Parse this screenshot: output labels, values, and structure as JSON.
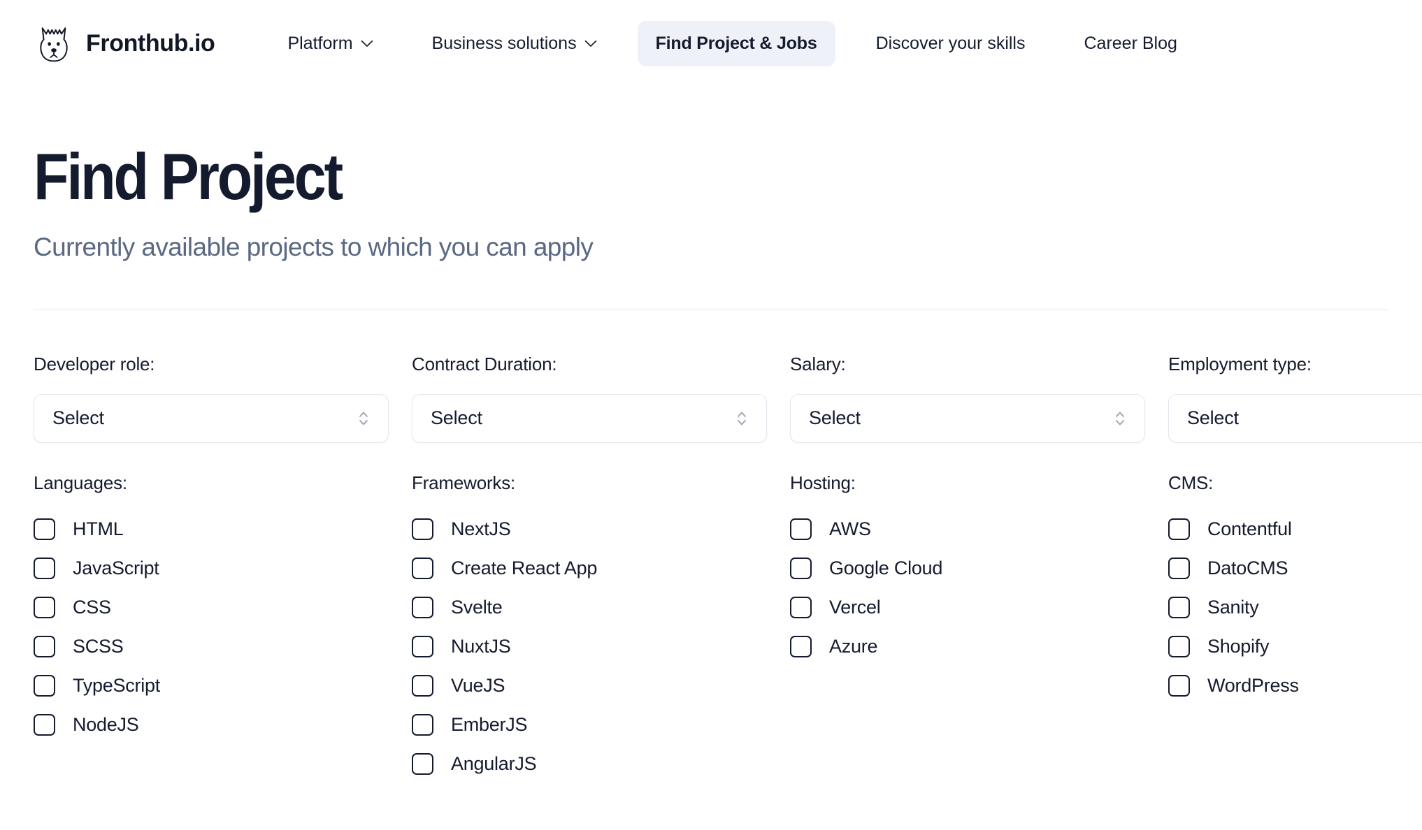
{
  "header": {
    "logo_icon": "dog-head-logo-icon",
    "brand": "Fronthub.io",
    "nav": [
      {
        "label": "Platform",
        "has_chevron": true,
        "active": false,
        "icon": "chevron-down-icon"
      },
      {
        "label": "Business solutions",
        "has_chevron": true,
        "active": false,
        "icon": "chevron-down-icon"
      },
      {
        "label": "Find Project & Jobs",
        "has_chevron": false,
        "active": true
      },
      {
        "label": "Discover your skills",
        "has_chevron": false,
        "active": false
      },
      {
        "label": "Career Blog",
        "has_chevron": false,
        "active": false
      }
    ]
  },
  "hero": {
    "title": "Find Project",
    "subtitle": "Currently available projects to which you can apply"
  },
  "filters": [
    {
      "label": "Developer role:",
      "value": "Select",
      "placeholder": "Select",
      "stepper_icon": "chevron-up-down-icon"
    },
    {
      "label": "Contract Duration:",
      "value": "Select",
      "placeholder": "Select",
      "stepper_icon": "chevron-up-down-icon"
    },
    {
      "label": "Salary:",
      "value": "Select",
      "placeholder": "Select",
      "stepper_icon": "chevron-up-down-icon"
    },
    {
      "label": "Employment type:",
      "value": "Select",
      "placeholder": "Select",
      "stepper_icon": "chevron-up-down-icon"
    }
  ],
  "groups": [
    {
      "title": "Languages:",
      "options": [
        {
          "label": "HTML",
          "checked": false
        },
        {
          "label": "JavaScript",
          "checked": false
        },
        {
          "label": "CSS",
          "checked": false
        },
        {
          "label": "SCSS",
          "checked": false
        },
        {
          "label": "TypeScript",
          "checked": false
        },
        {
          "label": "NodeJS",
          "checked": false
        }
      ]
    },
    {
      "title": "Frameworks:",
      "options": [
        {
          "label": "NextJS",
          "checked": false
        },
        {
          "label": "Create React App",
          "checked": false
        },
        {
          "label": "Svelte",
          "checked": false
        },
        {
          "label": "NuxtJS",
          "checked": false
        },
        {
          "label": "VueJS",
          "checked": false
        },
        {
          "label": "EmberJS",
          "checked": false
        },
        {
          "label": "AngularJS",
          "checked": false
        }
      ]
    },
    {
      "title": "Hosting:",
      "options": [
        {
          "label": "AWS",
          "checked": false
        },
        {
          "label": "Google Cloud",
          "checked": false
        },
        {
          "label": "Vercel",
          "checked": false
        },
        {
          "label": "Azure",
          "checked": false
        }
      ]
    },
    {
      "title": "CMS:",
      "options": [
        {
          "label": "Contentful",
          "checked": false
        },
        {
          "label": "DatoCMS",
          "checked": false
        },
        {
          "label": "Sanity",
          "checked": false
        },
        {
          "label": "Shopify",
          "checked": false
        },
        {
          "label": "WordPress",
          "checked": false
        }
      ]
    }
  ],
  "colors": {
    "text_dark": "#151b2e",
    "text_muted": "#5a6882",
    "active_pill": "#eef1f8",
    "border": "#e3e7ee",
    "divider": "#e6e9ef",
    "background": "#ffffff"
  }
}
